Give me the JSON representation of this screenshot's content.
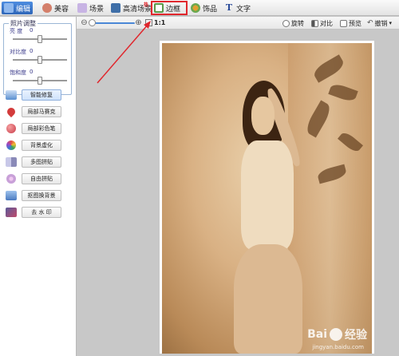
{
  "toolbar": {
    "tabs": [
      {
        "label": "编辑",
        "icon": "edit-icon",
        "color": "#3e7ad0"
      },
      {
        "label": "美容",
        "icon": "beauty-icon",
        "color": "#d47f6a"
      },
      {
        "label": "场景",
        "icon": "scene-icon",
        "color": "#9a7ac8"
      },
      {
        "label": "高清场景",
        "icon": "hd-scene-icon",
        "color": "#3f6fa8"
      },
      {
        "label": "边框",
        "icon": "frame-icon",
        "color": "#5a9a4a"
      },
      {
        "label": "饰品",
        "icon": "accessory-icon",
        "color": "#e0a030"
      },
      {
        "label": "文字",
        "icon": "text-icon",
        "color": "#2b4c9a"
      }
    ],
    "active_tab": "编辑",
    "highlighted_tab": "边框",
    "hot_badge": "热"
  },
  "subbar": {
    "zoom_minus": "⊖",
    "zoom_plus": "⊕",
    "zoom_level": 0.0,
    "ratio_label": "1:1",
    "buttons": [
      {
        "label": "旋转",
        "icon": "rotate-icon"
      },
      {
        "label": "对比",
        "icon": "compare-icon"
      },
      {
        "label": "预览",
        "icon": "preview-icon"
      },
      {
        "label": "撤销",
        "icon": "undo-icon"
      }
    ],
    "undo_arrow": "▾"
  },
  "adjust": {
    "title": "照片调整",
    "params": [
      {
        "label": "亮 度",
        "value": "0",
        "level": 0.5
      },
      {
        "label": "对比度",
        "value": "0",
        "level": 0.5
      },
      {
        "label": "饱和度",
        "value": "0",
        "level": 0.5
      }
    ]
  },
  "tools": [
    {
      "label": "智能修复",
      "icon": "smart-repair-icon",
      "color": "#5a8fd0",
      "active": true
    },
    {
      "label": "局部马赛克",
      "icon": "mosaic-icon",
      "color": "#d33b3b"
    },
    {
      "label": "局部彩色笔",
      "icon": "color-pen-icon",
      "color": "#c83a48"
    },
    {
      "label": "背景虚化",
      "icon": "blur-icon",
      "color": "#3ea35a"
    },
    {
      "label": "多图拼贴",
      "icon": "collage-icon",
      "color": "#8a8ab8"
    },
    {
      "label": "自由拼贴",
      "icon": "free-collage-icon",
      "color": "#c8a0d8"
    },
    {
      "label": "抠图换背景",
      "icon": "cutout-icon",
      "color": "#4a7ac0"
    },
    {
      "label": "去 水 印",
      "icon": "remove-watermark-icon",
      "color": "#5a5a9a"
    }
  ],
  "watermark": {
    "text": "Bai",
    "text2": "经验",
    "sub": "jingyan.baidu.com"
  },
  "accent": "#e0272d"
}
